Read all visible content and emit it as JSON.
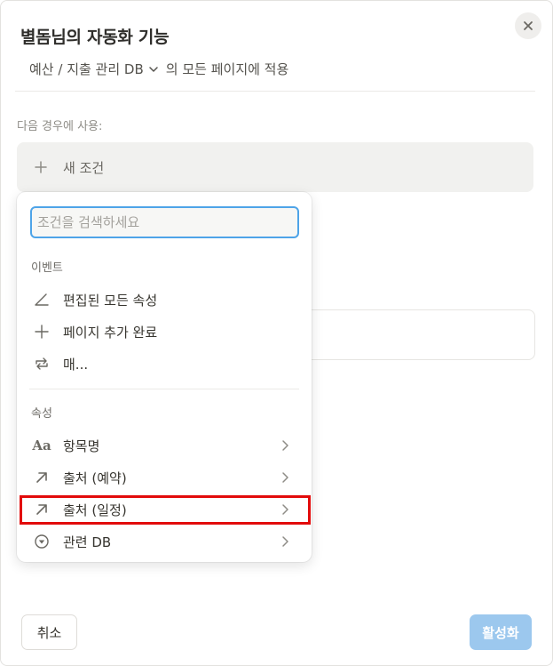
{
  "dialog": {
    "title": "별돔님의 자동화 기능",
    "database_name": "예산 / 지출 관리 DB",
    "applies_text": "의 모든 페이지에 적용",
    "trigger_label": "다음 경우에 사용:",
    "new_condition_label": "새 조건",
    "cancel_label": "취소",
    "activate_label": "활성화"
  },
  "dropdown": {
    "search_placeholder": "조건을 검색하세요",
    "events_label": "이벤트",
    "events": [
      {
        "label": "편집된 모든 속성",
        "icon": "pencil-icon"
      },
      {
        "label": "페이지 추가 완료",
        "icon": "plus-icon"
      },
      {
        "label": "매...",
        "icon": "repeat-icon"
      }
    ],
    "properties_label": "속성",
    "properties": [
      {
        "label": "항목명",
        "icon": "text-aa-icon"
      },
      {
        "label": "출처 (예약)",
        "icon": "relation-arrow-icon"
      },
      {
        "label": "출처 (일정)",
        "icon": "relation-arrow-icon"
      },
      {
        "label": "관련 DB",
        "icon": "select-circle-icon"
      }
    ]
  },
  "colors": {
    "accent": "#4ea4e8",
    "activate_button": "#9cc8ee",
    "highlight_border": "#e20b0b"
  }
}
